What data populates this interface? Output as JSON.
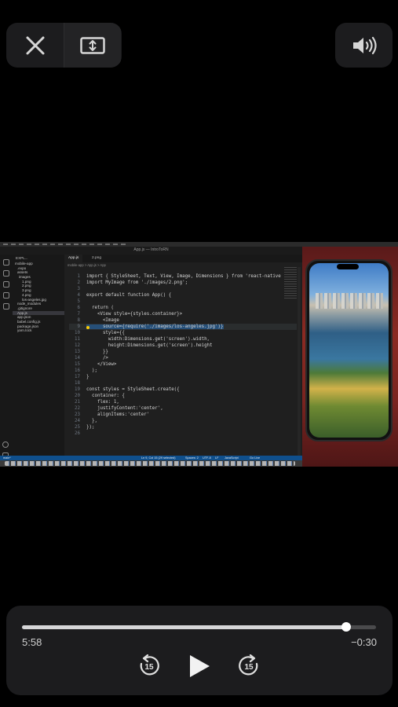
{
  "controls": {
    "close_icon": "xmark-icon",
    "resize_icon": "resize-vertical-icon",
    "volume_icon": "speaker-wave-icon"
  },
  "video": {
    "window_title": "App.js — IntroToRN",
    "tabs": [
      "App.js",
      "2.png"
    ],
    "breadcrumb": "mobile-app > App.js > App",
    "explorer": {
      "header": "EXPL...",
      "items": [
        "mobile-app",
        ".expo",
        "assets",
        "images",
        "1.png",
        "2.png",
        "3.png",
        "4.png",
        "los-angeles.jpg",
        "node_modules",
        ".gitignore",
        "App.js",
        "app.json",
        "babel.config.js",
        "package.json",
        "yarn.lock"
      ]
    },
    "code_lines": [
      {
        "n": "1",
        "text": "import { StyleSheet, Text, View, Image, Dimensions } from 'react-native"
      },
      {
        "n": "2",
        "text": "import MyImage from './images/2.png';"
      },
      {
        "n": "3",
        "text": ""
      },
      {
        "n": "4",
        "text": "export default function App() {"
      },
      {
        "n": "5",
        "text": ""
      },
      {
        "n": "6",
        "text": "  return ("
      },
      {
        "n": "7",
        "text": "    <View style={styles.container}>"
      },
      {
        "n": "8",
        "text": "      <Image"
      },
      {
        "n": "9",
        "text": "      source={require('./images/los-angeles.jpg')}"
      },
      {
        "n": "10",
        "text": "      style={{"
      },
      {
        "n": "11",
        "text": "        width:Dimensions.get('screen').width,"
      },
      {
        "n": "12",
        "text": "        height:Dimensions.get('screen').height"
      },
      {
        "n": "13",
        "text": "      }}"
      },
      {
        "n": "14",
        "text": "      />"
      },
      {
        "n": "15",
        "text": "    </View>"
      },
      {
        "n": "16",
        "text": "  );"
      },
      {
        "n": "17",
        "text": "}"
      },
      {
        "n": "18",
        "text": ""
      },
      {
        "n": "19",
        "text": "const styles = StyleSheet.create({"
      },
      {
        "n": "20",
        "text": "  container: {"
      },
      {
        "n": "21",
        "text": "    flex: 1,"
      },
      {
        "n": "22",
        "text": "    justifyContent:'center',"
      },
      {
        "n": "23",
        "text": "    alignItems:'center'"
      },
      {
        "n": "24",
        "text": "  },"
      },
      {
        "n": "25",
        "text": "});"
      },
      {
        "n": "26",
        "text": ""
      }
    ],
    "status": {
      "branch": "main*",
      "position": "Ln 9, Col 15 (29 selected)",
      "spaces": "Spaces: 2",
      "encoding": "UTF-8",
      "eol": "LF",
      "language": "JavaScript",
      "golive": "Go Live"
    }
  },
  "player": {
    "elapsed": "5:58",
    "remaining": "−0:30",
    "progress": 0.916,
    "skip_back_label": "15",
    "skip_forward_label": "15"
  }
}
